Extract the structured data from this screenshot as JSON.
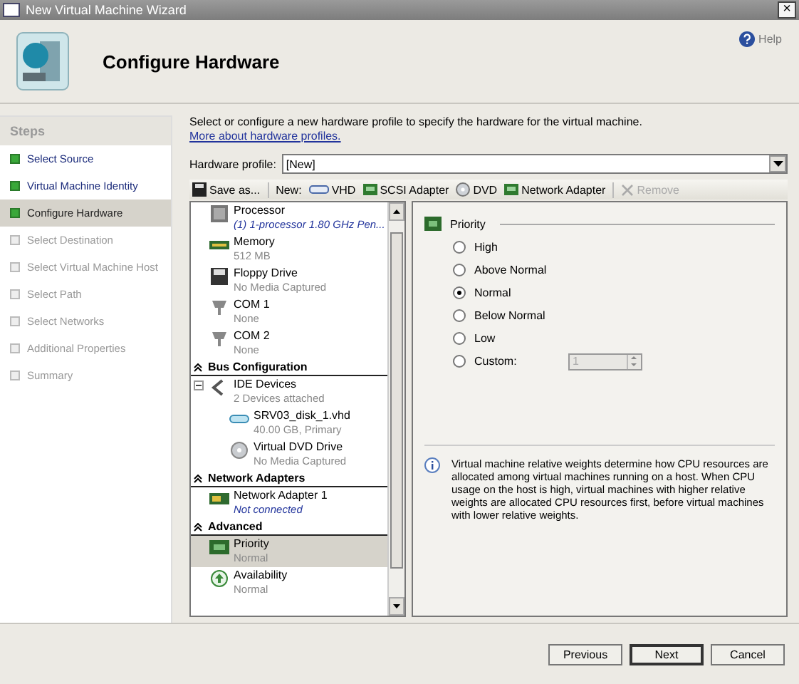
{
  "window": {
    "title": "New Virtual Machine Wizard",
    "close": "×"
  },
  "header": {
    "title": "Configure Hardware",
    "help": "Help"
  },
  "steps": {
    "title": "Steps",
    "items": [
      {
        "label": "Select Source",
        "completed": true,
        "selected": false
      },
      {
        "label": "Virtual Machine Identity",
        "completed": true,
        "selected": false
      },
      {
        "label": "Configure Hardware",
        "completed": true,
        "selected": true
      },
      {
        "label": "Select Destination",
        "completed": false,
        "selected": false
      },
      {
        "label": "Select Virtual Machine Host",
        "completed": false,
        "selected": false
      },
      {
        "label": "Select Path",
        "completed": false,
        "selected": false
      },
      {
        "label": "Select Networks",
        "completed": false,
        "selected": false
      },
      {
        "label": "Additional Properties",
        "completed": false,
        "selected": false
      },
      {
        "label": "Summary",
        "completed": false,
        "selected": false
      }
    ]
  },
  "intro": {
    "text": "Select or configure a new hardware profile to specify the hardware for the virtual machine.",
    "link": "More about hardware profiles."
  },
  "profile": {
    "label": "Hardware profile:",
    "value": "[New]"
  },
  "toolbar": {
    "save": "Save as...",
    "new_label": "New:",
    "items": [
      {
        "kind": "vhd",
        "label": "VHD",
        "disabled": false
      },
      {
        "kind": "scsi",
        "label": "SCSI Adapter",
        "disabled": false
      },
      {
        "kind": "dvd",
        "label": "DVD",
        "disabled": false
      },
      {
        "kind": "network",
        "label": "Network Adapter",
        "disabled": false
      },
      {
        "kind": "remove",
        "label": "Remove",
        "disabled": true
      }
    ]
  },
  "hardware": [
    {
      "kind": "processor",
      "name": "Processor",
      "detail": "(1) 1-processor 1.80 GHz Pen...",
      "emphasized": true,
      "selected": false
    },
    {
      "kind": "memory",
      "name": "Memory",
      "detail": "512 MB",
      "emphasized": false,
      "selected": false
    },
    {
      "kind": "floppy",
      "name": "Floppy Drive",
      "detail": "No Media Captured",
      "emphasized": false,
      "selected": false
    },
    {
      "kind": "port",
      "name": "COM 1",
      "detail": "None",
      "emphasized": false,
      "selected": false
    },
    {
      "kind": "port",
      "name": "COM 2",
      "detail": "None",
      "emphasized": false,
      "selected": false
    },
    {
      "kind": "section",
      "name": "Bus Configuration",
      "expanded": true
    },
    {
      "kind": "bus",
      "name": "IDE Devices",
      "detail": "2 Devices attached",
      "emphasized": false,
      "selected": false,
      "expanded": true,
      "children": [
        {
          "kind": "disk",
          "name": "SRV03_disk_1.vhd",
          "detail": "40.00 GB, Primary",
          "emphasized": false,
          "selected": false
        },
        {
          "kind": "dvd",
          "name": "Virtual DVD Drive",
          "detail": "No Media Captured",
          "emphasized": false,
          "selected": false
        }
      ]
    },
    {
      "kind": "section",
      "name": "Network Adapters",
      "expanded": true
    },
    {
      "kind": "network",
      "name": "Network Adapter 1",
      "detail": "Not connected",
      "emphasized": true,
      "selected": false
    },
    {
      "kind": "section",
      "name": "Advanced",
      "expanded": true
    },
    {
      "kind": "priority",
      "name": "Priority",
      "detail": "Normal",
      "emphasized": false,
      "selected": true
    },
    {
      "kind": "availability",
      "name": "Availability",
      "detail": "Normal",
      "emphasized": false,
      "selected": false
    }
  ],
  "priority": {
    "title": "Priority",
    "options": [
      {
        "label": "High",
        "selected": false
      },
      {
        "label": "Above Normal",
        "selected": false
      },
      {
        "label": "Normal",
        "selected": true
      },
      {
        "label": "Below Normal",
        "selected": false
      },
      {
        "label": "Low",
        "selected": false
      },
      {
        "label": "Custom:",
        "selected": false,
        "value": "1",
        "disabled": true
      }
    ],
    "info": "Virtual machine relative weights determine how CPU resources are allocated among virtual machines running on a host. When CPU usage on the host is high, virtual machines with higher relative weights are allocated CPU resources first, before virtual machines with lower relative weights."
  },
  "buttons": [
    {
      "label": "Previous",
      "default": false
    },
    {
      "label": "Next",
      "default": true
    },
    {
      "label": "Cancel",
      "default": false
    }
  ]
}
